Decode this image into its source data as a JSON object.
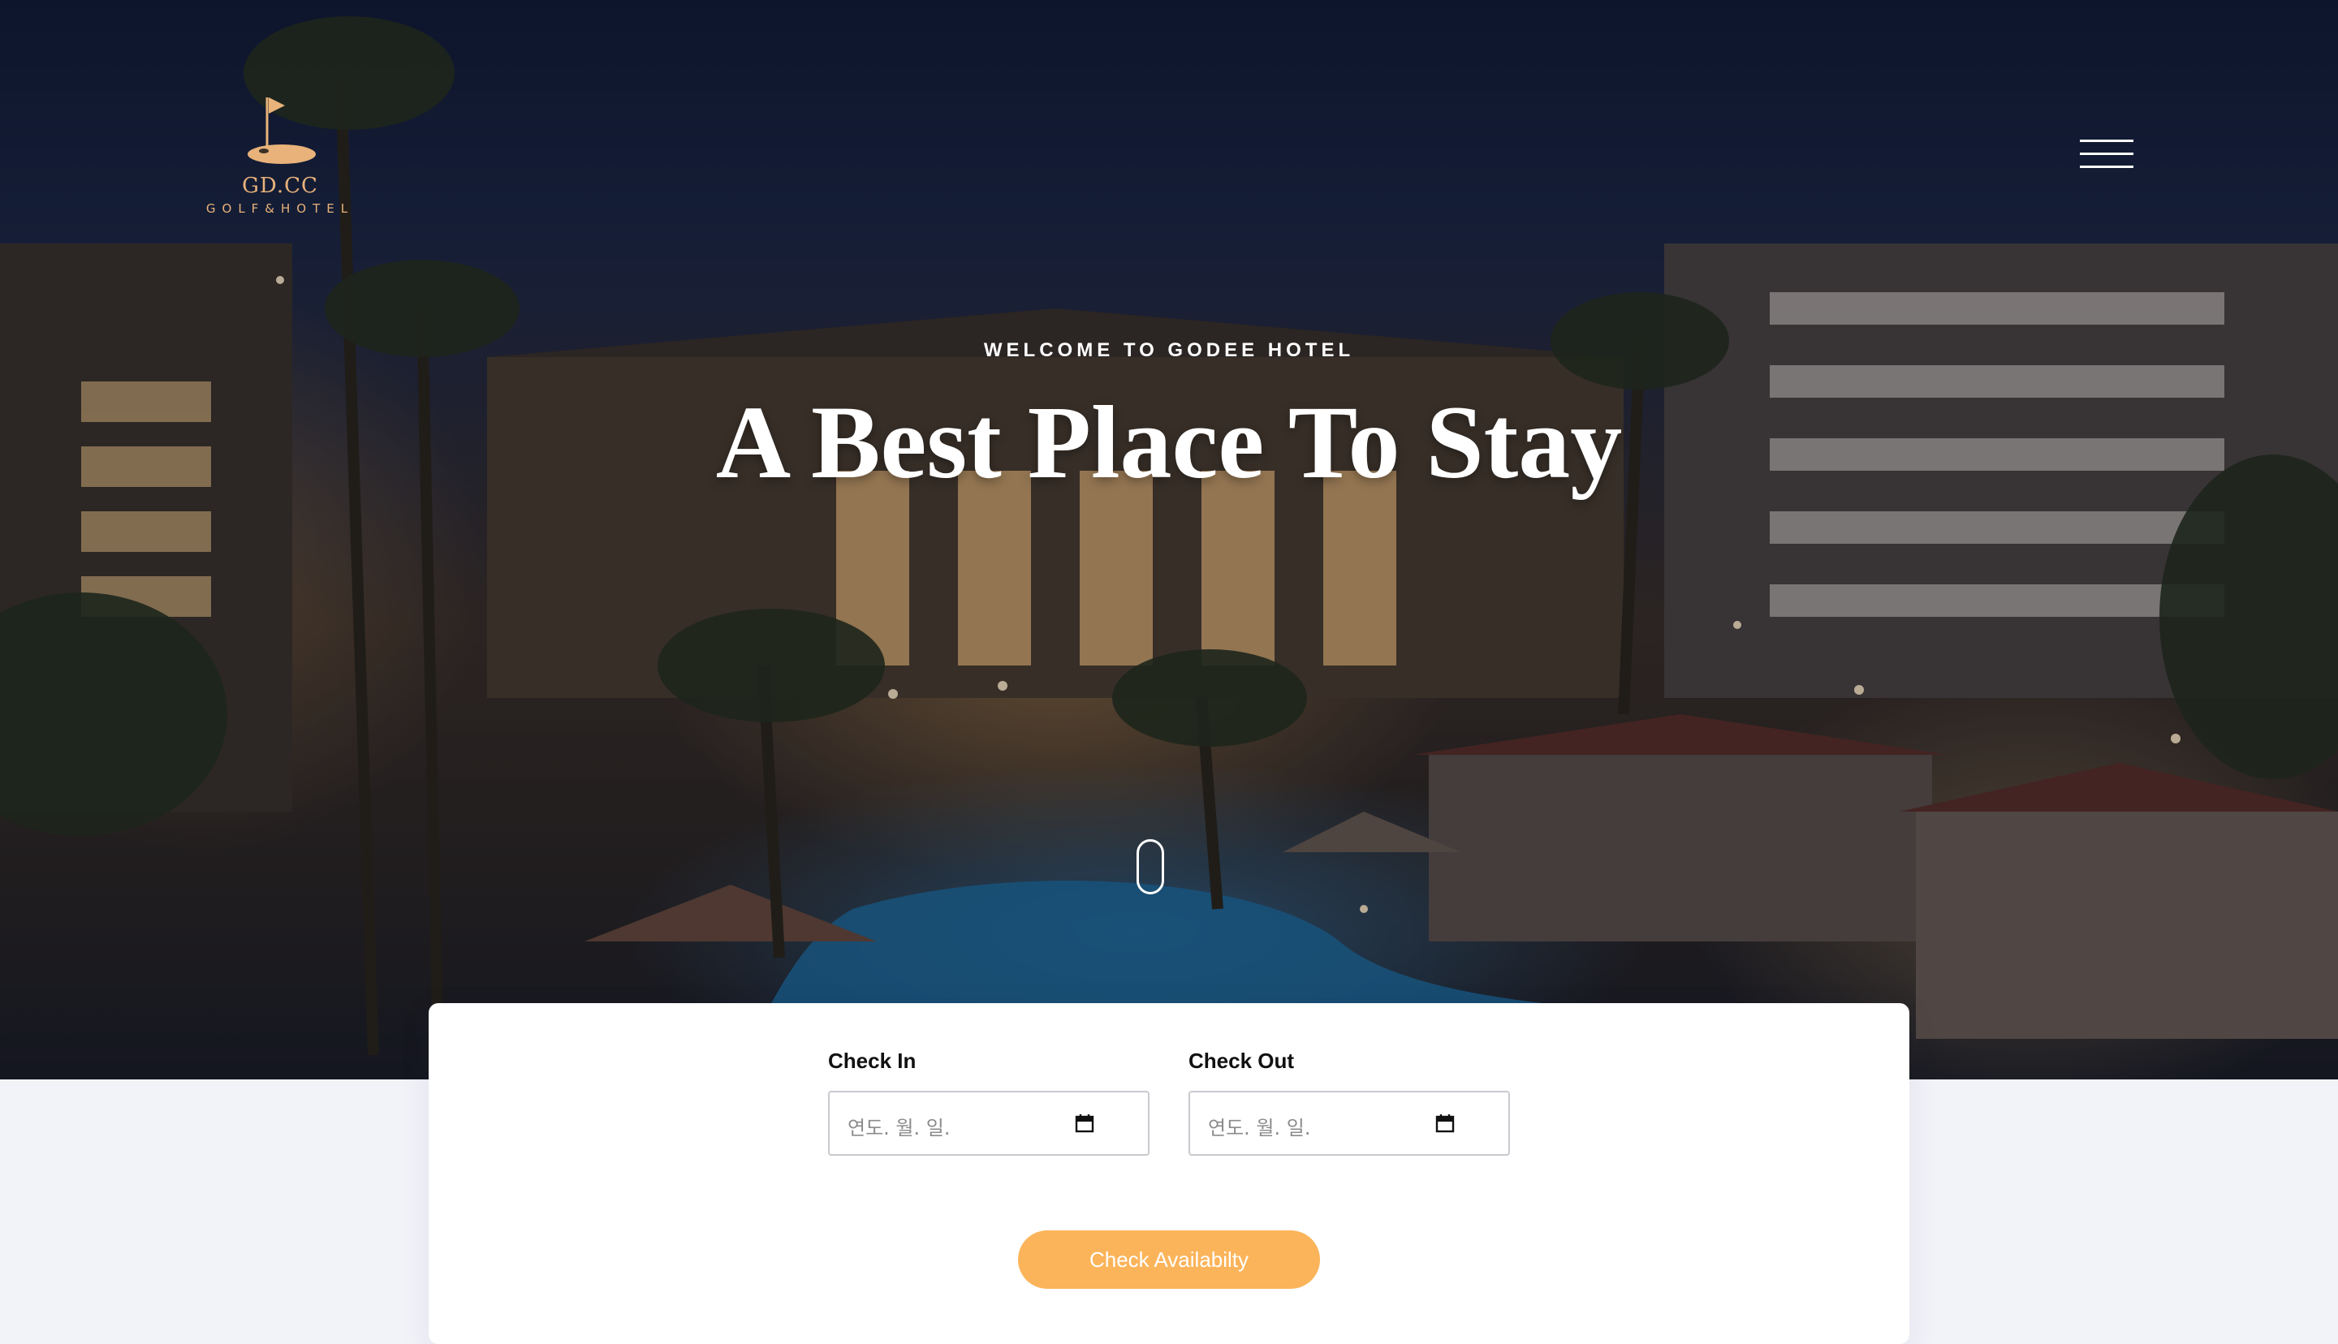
{
  "brand": {
    "name": "GD.CC",
    "tagline": "GOLF&HOTEL",
    "accent_color": "#e8b27a"
  },
  "nav": {
    "menu_icon": "hamburger-menu-icon"
  },
  "hero": {
    "eyebrow": "WELCOME TO GODEE HOTEL",
    "headline": "A Best Place To Stay",
    "scroll_icon": "mouse-scroll-icon"
  },
  "booking": {
    "check_in": {
      "label": "Check In",
      "placeholder": "연도. 월. 일.",
      "icon": "calendar-icon"
    },
    "check_out": {
      "label": "Check Out",
      "placeholder": "연도. 월. 일.",
      "icon": "calendar-icon"
    },
    "submit_label": "Check Availabilty",
    "button_color": "#fbb45a"
  }
}
